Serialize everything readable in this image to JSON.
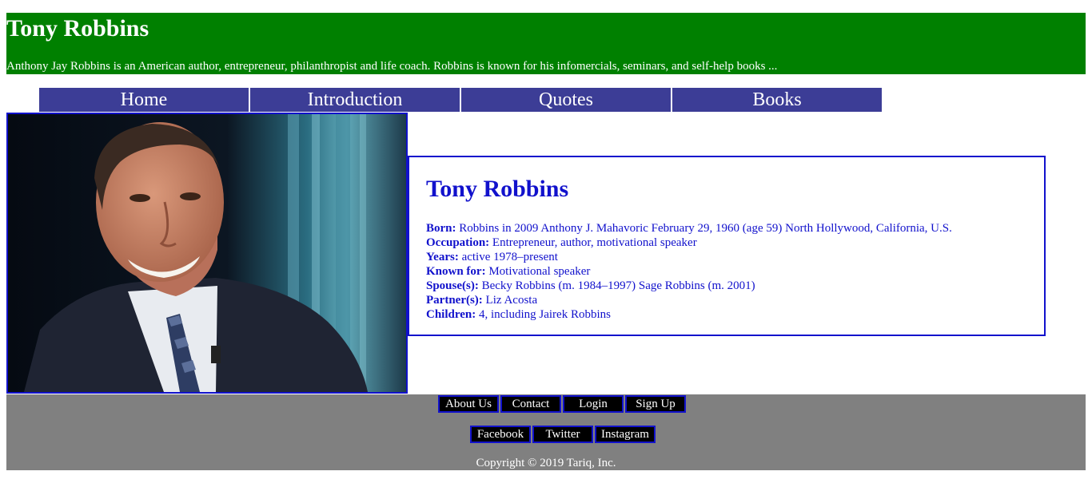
{
  "header": {
    "title": "Tony Robbins",
    "tagline": "Anthony Jay Robbins is an American author, entrepreneur, philanthropist and life coach. Robbins is known for his infomercials, seminars, and self-help books ..."
  },
  "nav": {
    "items": [
      "Home",
      "Introduction",
      "Quotes",
      "Books"
    ]
  },
  "profile": {
    "name": "Tony Robbins",
    "facts": [
      {
        "key": "Born:",
        "value": " Robbins in 2009 Anthony J. Mahavoric February 29, 1960 (age 59) North Hollywood, California, U.S."
      },
      {
        "key": "Occupation:",
        "value": " Entrepreneur, author, motivational speaker"
      },
      {
        "key": "Years:",
        "value": " active 1978–present"
      },
      {
        "key": "Known for:",
        "value": " Motivational speaker"
      },
      {
        "key": "Spouse(s):",
        "value": " Becky Robbins (m. 1984–1997) Sage Robbins (m. 2001)"
      },
      {
        "key": "Partner(s):",
        "value": " Liz Acosta"
      },
      {
        "key": "Children:",
        "value": " 4, including Jairek Robbins"
      }
    ]
  },
  "footer": {
    "links": [
      "About Us",
      "Contact",
      "Login",
      "Sign Up"
    ],
    "social": [
      "Facebook",
      "Twitter",
      "Instagram"
    ],
    "copyright": "Copyright © 2019 Tariq, Inc."
  },
  "colors": {
    "header_bg": "#008000",
    "nav_bg": "#3c3d96",
    "accent_blue": "#1111cc",
    "footer_bg": "#808080"
  }
}
